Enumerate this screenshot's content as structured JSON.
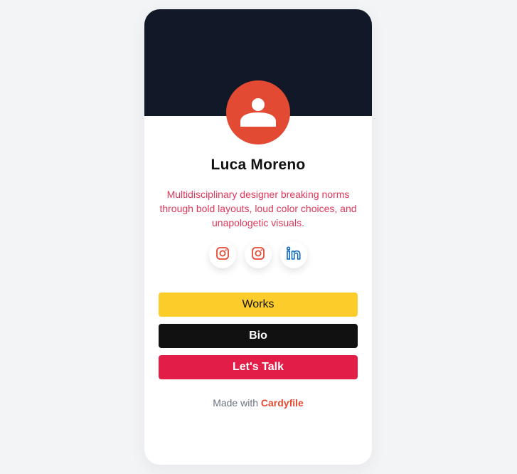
{
  "profile": {
    "name": "Luca Moreno",
    "bio": "Multidisciplinary designer breaking norms through bold layouts, loud color choices, and unapologetic visuals.",
    "avatar_icon": "user-icon"
  },
  "social_links": [
    {
      "icon": "instagram-icon",
      "color": "#e34a34"
    },
    {
      "icon": "instagram-icon",
      "color": "#e34a34"
    },
    {
      "icon": "linkedin-icon",
      "color": "#0a66c2"
    }
  ],
  "buttons": {
    "works": "Works",
    "bio": "Bio",
    "talk": "Let's Talk"
  },
  "footer": {
    "prefix": "Made with",
    "brand": "Cardyfile"
  },
  "colors": {
    "banner": "#111827",
    "avatar": "#e34a34",
    "bio_text": "#e0375a",
    "works_button": "#fccc2a",
    "bio_button": "#111111",
    "talk_button": "#e11d48",
    "brand": "#e34a34"
  }
}
